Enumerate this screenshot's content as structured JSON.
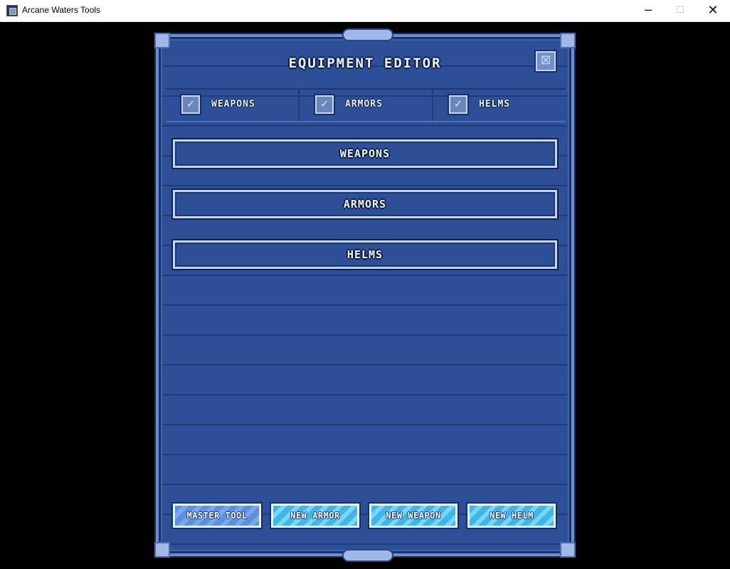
{
  "window": {
    "title": "Arcane Waters Tools",
    "minimize_glyph": "─",
    "maximize_glyph": "☐",
    "close_glyph": "✕"
  },
  "panel": {
    "title": "EQUIPMENT EDITOR",
    "close_glyph": "⊠",
    "tabs": [
      {
        "label": "WEAPONS",
        "checked": true,
        "check_glyph": "✓"
      },
      {
        "label": "ARMORS",
        "checked": true,
        "check_glyph": "✓"
      },
      {
        "label": "HELMS",
        "checked": true,
        "check_glyph": "✓"
      }
    ],
    "sections": [
      {
        "label": "WEAPONS"
      },
      {
        "label": "ARMORS"
      },
      {
        "label": "HELMS"
      }
    ],
    "actions": {
      "master_tool": "MASTER TOOL",
      "new_armor": "NEW ARMOR",
      "new_weapon": "NEW WEAPON",
      "new_helm": "NEW HELM"
    }
  },
  "colors": {
    "panel_bg": "#2c4f97",
    "panel_border": "#6d8fd0",
    "action_primary": "#5d8ee0",
    "action_secondary": "#3fb5e8"
  }
}
